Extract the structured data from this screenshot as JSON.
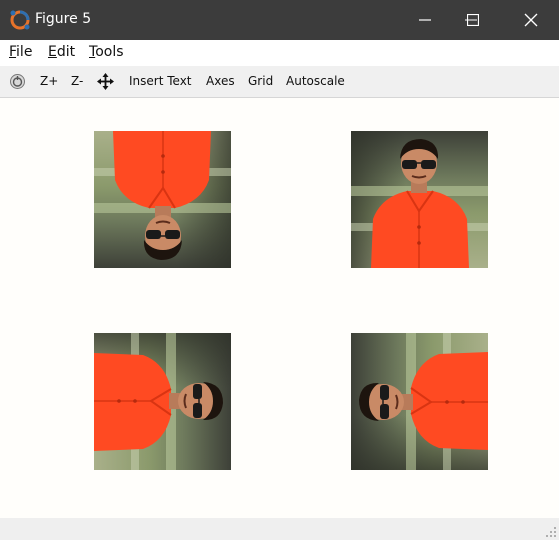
{
  "window": {
    "title": "Figure 5"
  },
  "menu": [
    {
      "accel": "F",
      "rest": "ile"
    },
    {
      "accel": "E",
      "rest": "dit"
    },
    {
      "accel": "T",
      "rest": "ools"
    }
  ],
  "toolbar": {
    "rotate_icon": "rotate-icon",
    "zoom_in": "Z+",
    "zoom_out": "Z-",
    "pan_icon": "pan-icon",
    "insert_text": "Insert Text",
    "axes": "Axes",
    "grid": "Grid",
    "autoscale": "Autoscale"
  },
  "subplots": [
    {
      "content": "person photo, orange shirt, rotated 180 degrees (upside down)",
      "rotation_deg": 180
    },
    {
      "content": "person photo, orange shirt, upright",
      "rotation_deg": 0
    },
    {
      "content": "person photo, orange shirt, rotated 90 degrees clockwise",
      "rotation_deg": 90
    },
    {
      "content": "person photo, orange shirt, rotated 90 degrees counter-clockwise",
      "rotation_deg": -90
    }
  ],
  "colors": {
    "titlebar": "#3c3c3c",
    "toolbar": "#f0f0f0",
    "canvas": "#fffefb",
    "shirt": "#ff4a22"
  }
}
